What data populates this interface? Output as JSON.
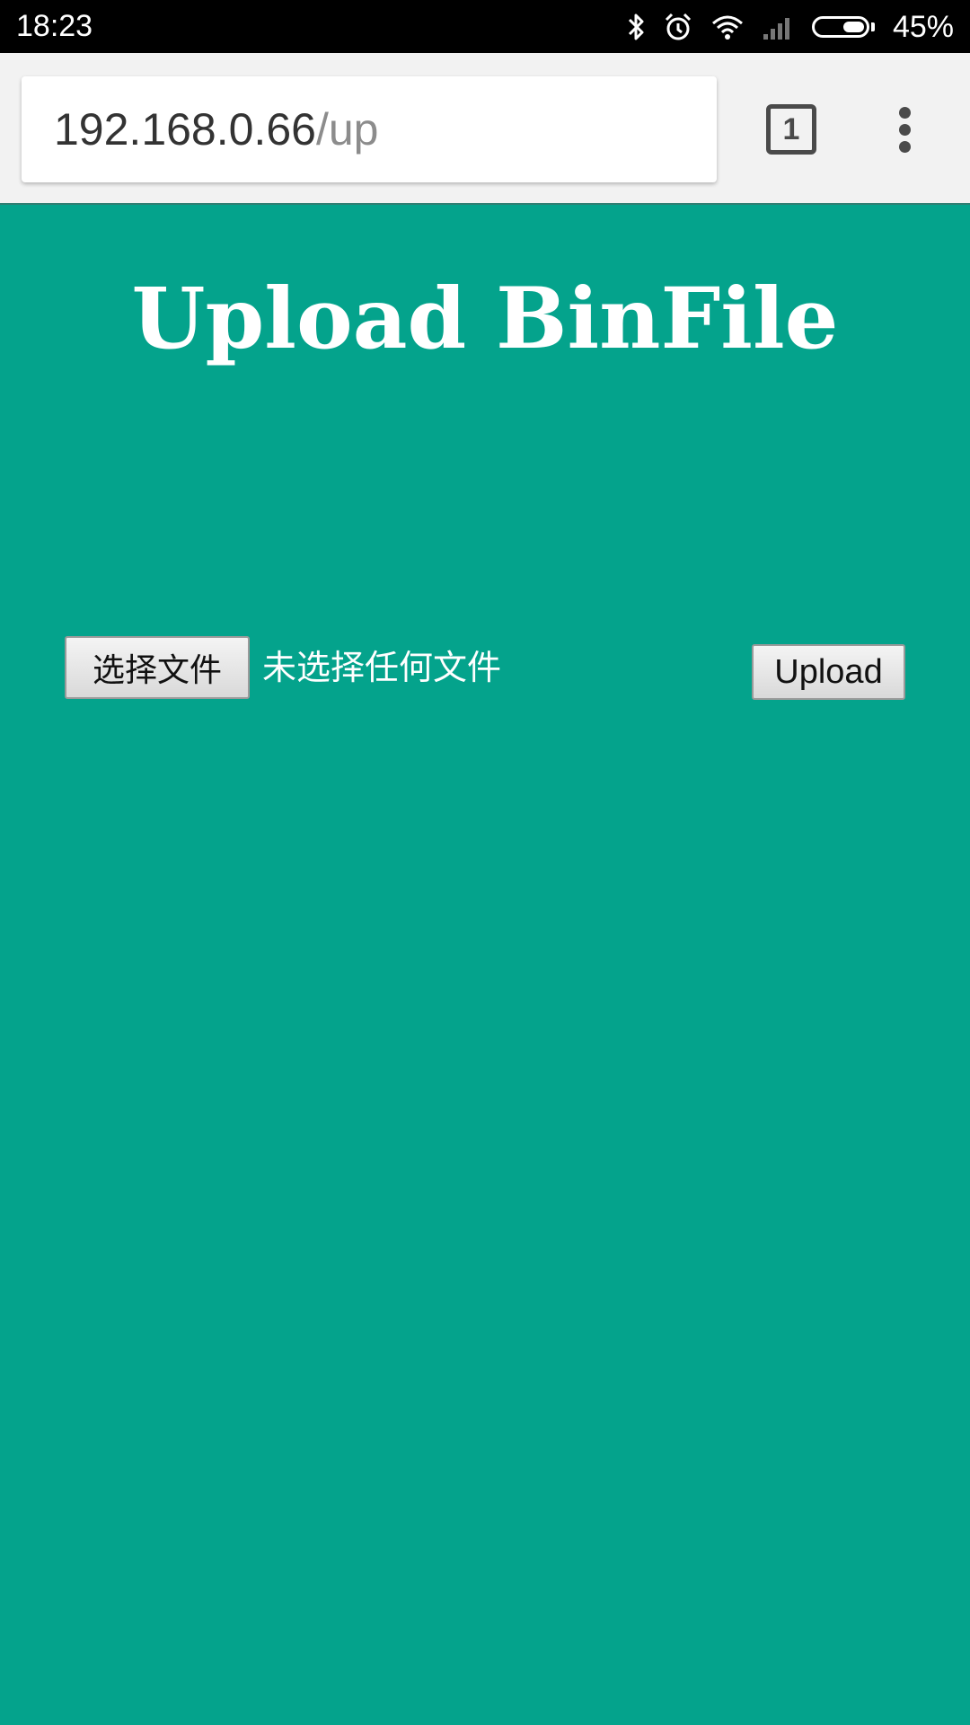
{
  "status_bar": {
    "time": "18:23",
    "icons": [
      "bluetooth-icon",
      "alarm-icon",
      "wifi-icon",
      "cell-signal-icon",
      "battery-icon"
    ],
    "battery_percent_text": "45%",
    "battery_level": 0.45
  },
  "browser": {
    "url_host": "192.168.0.66",
    "url_path": "/up",
    "tab_count": "1",
    "menu_icon": "more-vert-icon"
  },
  "page": {
    "title": "Upload BinFile",
    "choose_file_label": "选择文件",
    "no_file_text": "未选择任何文件",
    "upload_label": "Upload"
  },
  "colors": {
    "page_background": "#04a38c",
    "toolbar_background": "#f2f2f2",
    "status_bar_background": "#000000",
    "title_color": "#ffffff"
  }
}
